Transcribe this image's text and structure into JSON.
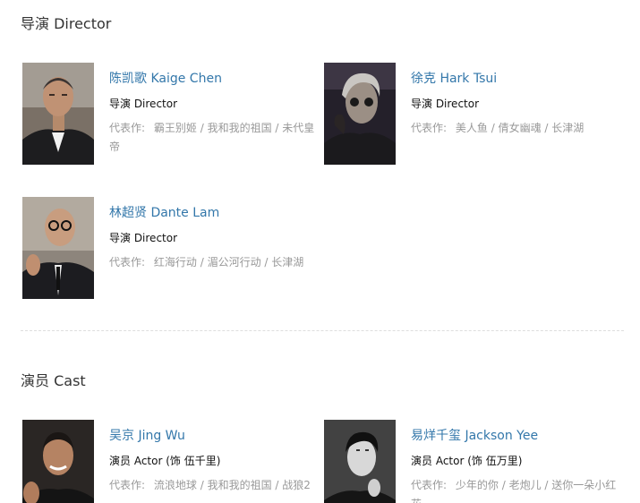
{
  "directors_section": {
    "title": "导演 Director",
    "people": [
      {
        "name": "陈凯歌 Kaige Chen",
        "role": "导演 Director",
        "works_label": "代表作:",
        "works": [
          "霸王别姬",
          "我和我的祖国",
          "未代皇帝"
        ]
      },
      {
        "name": "徐克 Hark Tsui",
        "role": "导演 Director",
        "works_label": "代表作:",
        "works": [
          "美人鱼",
          "倩女幽魂",
          "长津湖"
        ]
      },
      {
        "name": "林超贤 Dante Lam",
        "role": "导演 Director",
        "works_label": "代表作:",
        "works": [
          "红海行动",
          "湄公河行动",
          "长津湖"
        ]
      }
    ]
  },
  "cast_section": {
    "title": "演员 Cast",
    "people": [
      {
        "name": "吴京 Jing Wu",
        "role": "演员 Actor (饰 伍千里)",
        "works_label": "代表作:",
        "works": [
          "流浪地球",
          "我和我的祖国",
          "战狼2"
        ]
      },
      {
        "name": "易烊千玺 Jackson Yee",
        "role": "演员 Actor (饰 伍万里)",
        "works_label": "代表作:",
        "works": [
          "少年的你",
          "老炮儿",
          "送你一朵小红花"
        ]
      }
    ]
  }
}
